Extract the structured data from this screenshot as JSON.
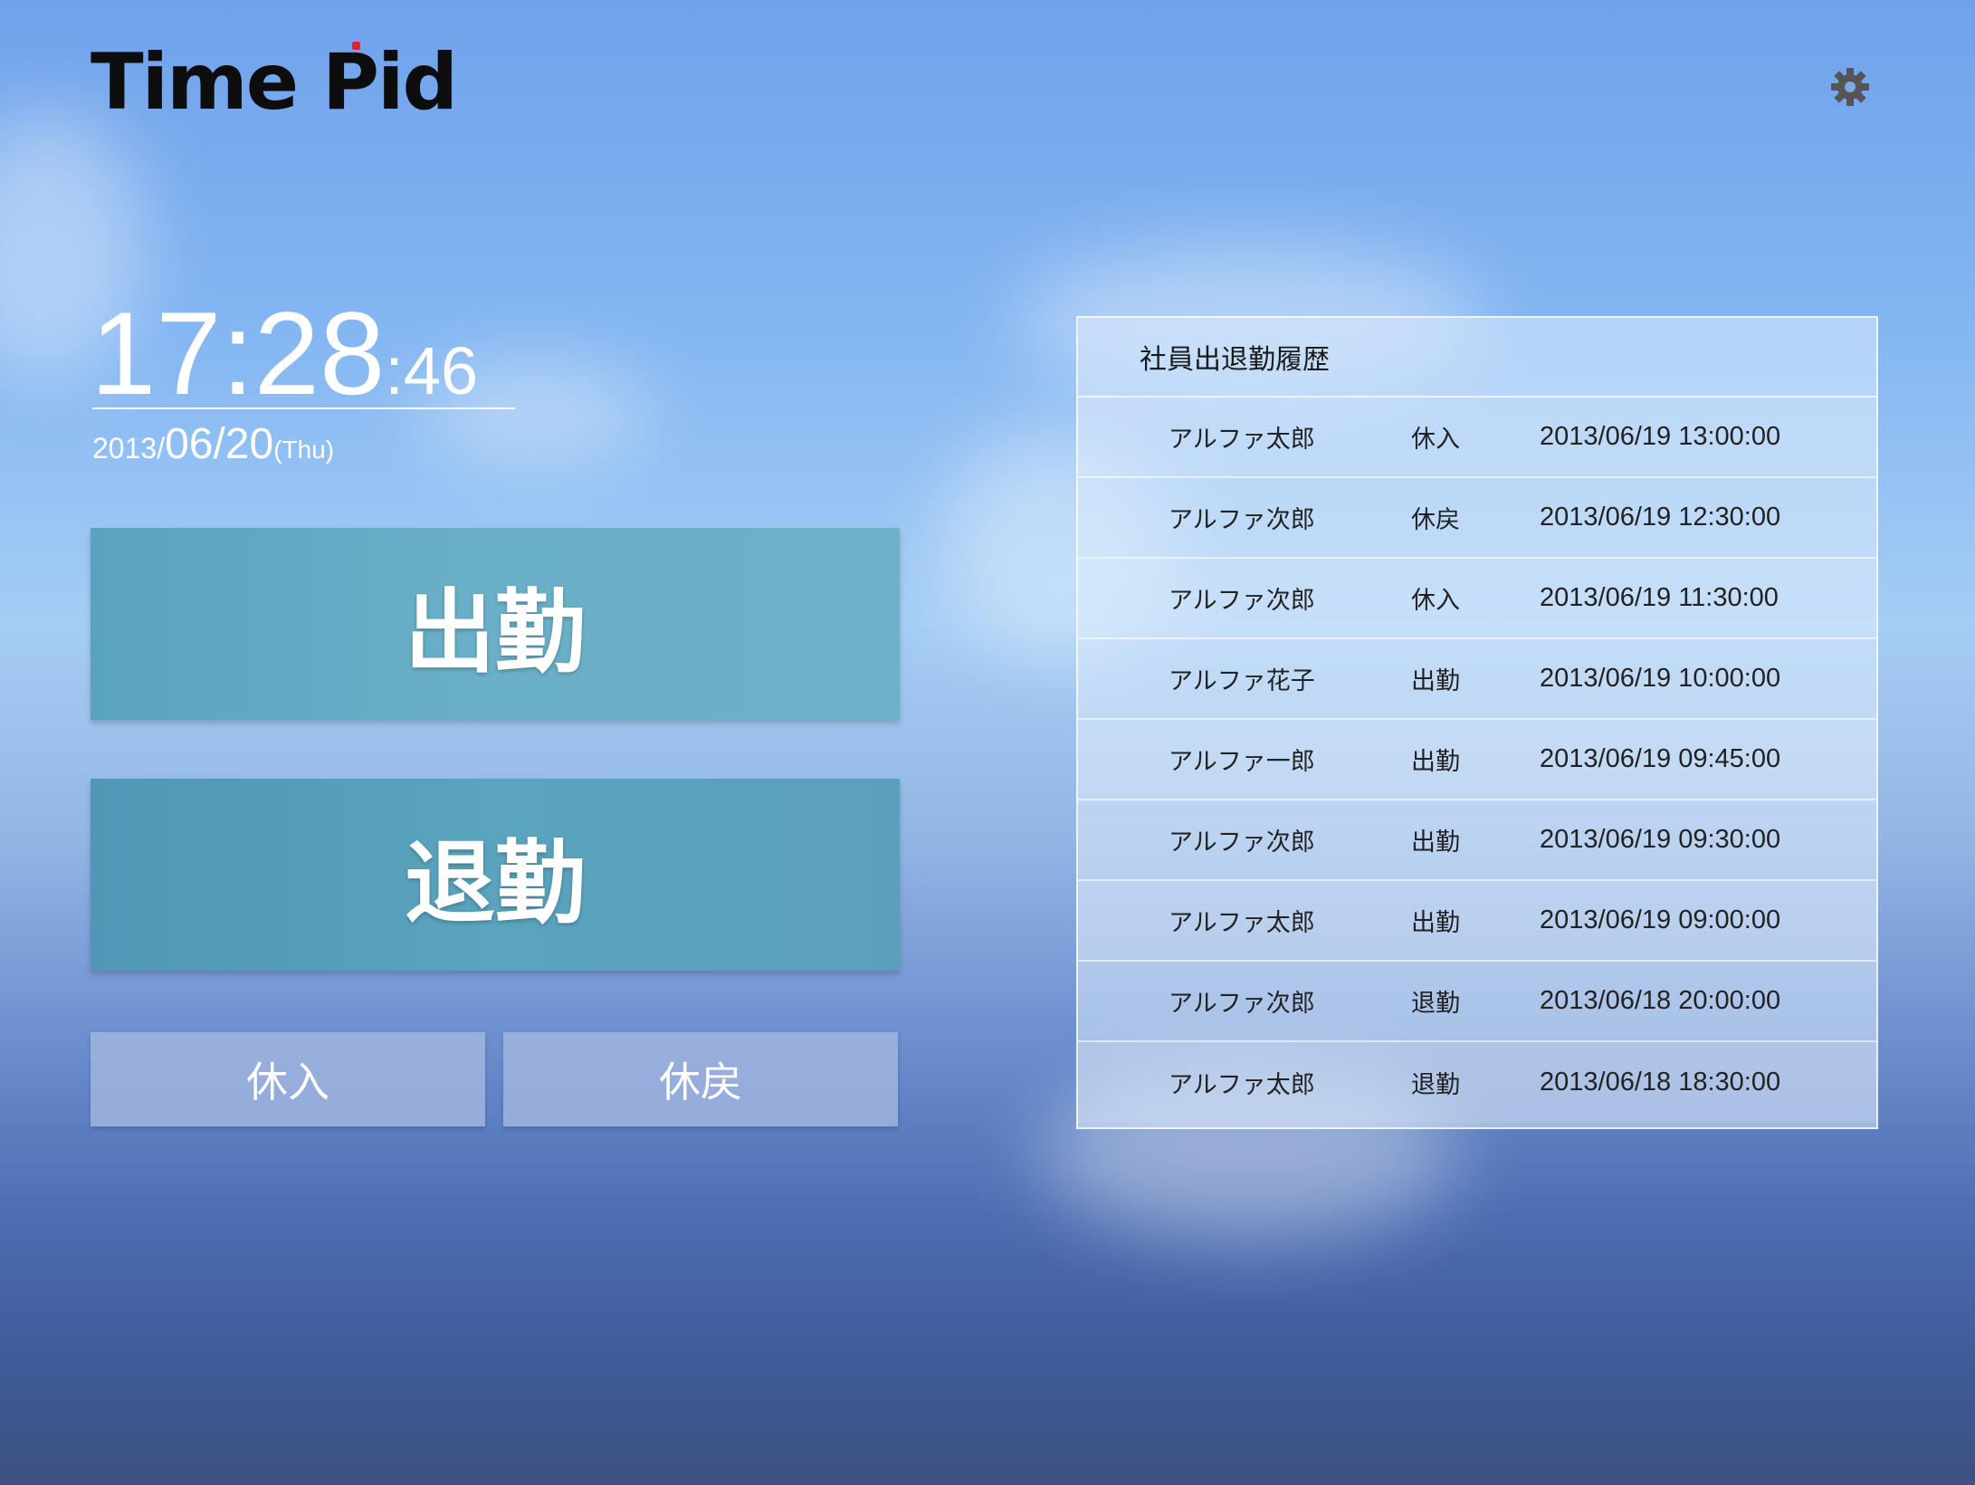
{
  "app": {
    "logo": "Time Pid",
    "logo_accent_color": "#e8202a"
  },
  "header": {
    "settings_icon": "gear-icon"
  },
  "clock": {
    "hours_minutes": "17:28",
    "seconds": ":46",
    "date_year": "2013/",
    "date_month_day": "06/20",
    "date_weekday": "(Thu)"
  },
  "actions": {
    "clock_in_label": "出勤",
    "clock_out_label": "退勤",
    "break_in_label": "休入",
    "break_out_label": "休戻"
  },
  "history": {
    "title": "社員出退勤履歴",
    "rows": [
      {
        "name": "アルファ太郎",
        "type": "休入",
        "time": "2013/06/19 13:00:00"
      },
      {
        "name": "アルファ次郎",
        "type": "休戻",
        "time": "2013/06/19 12:30:00"
      },
      {
        "name": "アルファ次郎",
        "type": "休入",
        "time": "2013/06/19 11:30:00"
      },
      {
        "name": "アルファ花子",
        "type": "出勤",
        "time": "2013/06/19 10:00:00"
      },
      {
        "name": "アルファ一郎",
        "type": "出勤",
        "time": "2013/06/19 09:45:00"
      },
      {
        "name": "アルファ次郎",
        "type": "出勤",
        "time": "2013/06/19 09:30:00"
      },
      {
        "name": "アルファ太郎",
        "type": "出勤",
        "time": "2013/06/19 09:00:00"
      },
      {
        "name": "アルファ次郎",
        "type": "退勤",
        "time": "2013/06/18 20:00:00"
      },
      {
        "name": "アルファ太郎",
        "type": "退勤",
        "time": "2013/06/18 18:30:00"
      }
    ]
  }
}
